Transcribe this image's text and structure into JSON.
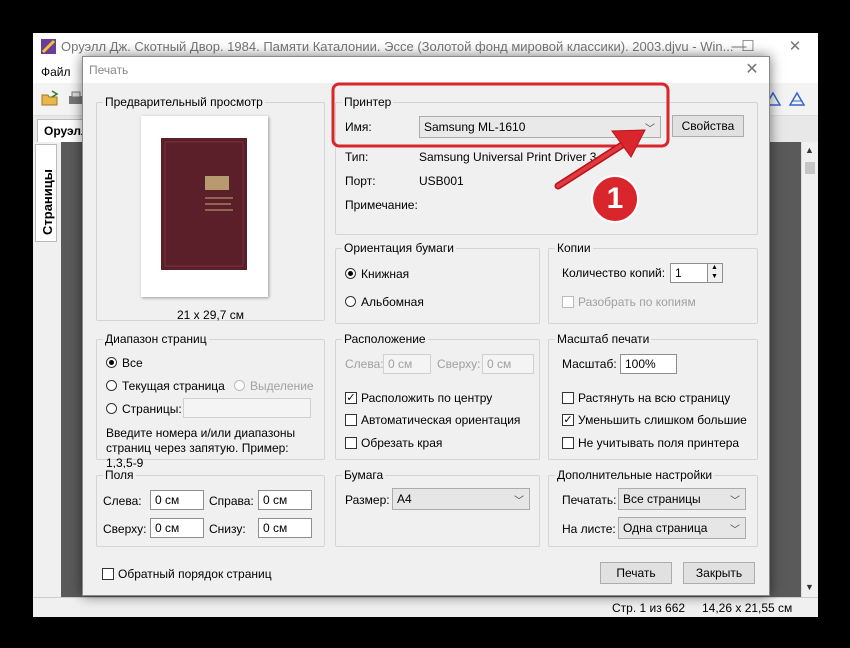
{
  "app": {
    "title": "Оруэлл Дж. Скотный Двор. 1984. Памяти Каталонии. Эссе (Золотой фонд мировой классики). 2003.djvu - Win...",
    "menu_file": "Файл",
    "doc_tab": "Оруэлл",
    "side_tab": "Страницы",
    "status_page": "Стр. 1 из 662",
    "status_size": "14,26 x 21,55 см"
  },
  "dialog": {
    "title": "Печать",
    "preview": {
      "label": "Предварительный просмотр",
      "size": "21 x 29,7 см"
    },
    "printer": {
      "label": "Принтер",
      "name_label": "Имя:",
      "name_value": "Samsung ML-1610",
      "properties_button": "Свойства",
      "type_label": "Тип:",
      "type_value": "Samsung Universal Print Driver 3",
      "port_label": "Порт:",
      "port_value": "USB001",
      "note_label": "Примечание:"
    },
    "orientation": {
      "label": "Ориентация бумаги",
      "portrait": "Книжная",
      "landscape": "Альбомная"
    },
    "copies": {
      "label": "Копии",
      "count_label": "Количество копий:",
      "count_value": "1",
      "collate": "Разобрать по копиям"
    },
    "range": {
      "label": "Диапазон страниц",
      "all": "Все",
      "current": "Текущая страница",
      "selection": "Выделение",
      "pages": "Страницы:",
      "hint": "Введите номера и/или диапазоны страниц через запятую. Пример: 1,3,5-9"
    },
    "position": {
      "label": "Расположение",
      "left_label": "Слева:",
      "left_value": "0 см",
      "top_label": "Сверху:",
      "top_value": "0 см",
      "center": "Расположить по центру",
      "auto_orient": "Автоматическая ориентация",
      "crop": "Обрезать края"
    },
    "scale": {
      "label": "Масштаб печати",
      "scale_label": "Масштаб:",
      "scale_value": "100%",
      "stretch": "Растянуть на всю страницу",
      "shrink": "Уменьшить слишком большие",
      "ignore_margins": "Не учитывать поля принтера"
    },
    "margins": {
      "label": "Поля",
      "left_label": "Слева:",
      "left_value": "0 см",
      "right_label": "Справа:",
      "right_value": "0 см",
      "top_label": "Сверху:",
      "top_value": "0 см",
      "bottom_label": "Снизу:",
      "bottom_value": "0 см"
    },
    "paper": {
      "label": "Бумага",
      "size_label": "Размер:",
      "size_value": "A4"
    },
    "extra": {
      "label": "Дополнительные настройки",
      "print_label": "Печатать:",
      "print_value": "Все страницы",
      "sheet_label": "На листе:",
      "sheet_value": "Одна страница"
    },
    "reverse_order": "Обратный порядок страниц",
    "print_button": "Печать",
    "close_button": "Закрыть"
  },
  "annotation": {
    "number": "1",
    "color": "#d9262c"
  }
}
